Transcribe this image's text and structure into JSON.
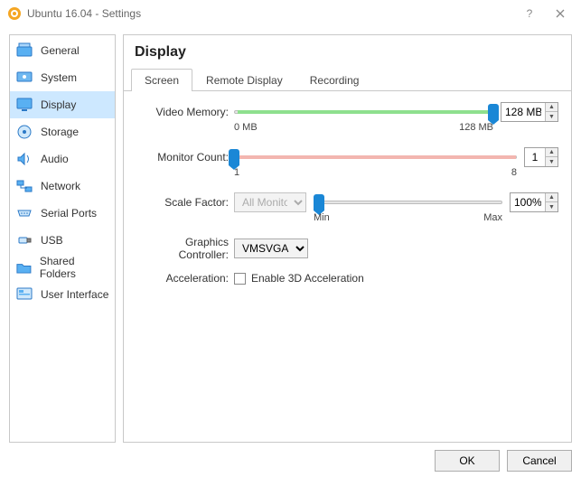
{
  "window": {
    "app": "Ubuntu 16.04",
    "suffix": "Settings"
  },
  "sidebar": {
    "items": [
      {
        "label": "General"
      },
      {
        "label": "System"
      },
      {
        "label": "Display"
      },
      {
        "label": "Storage"
      },
      {
        "label": "Audio"
      },
      {
        "label": "Network"
      },
      {
        "label": "Serial Ports"
      },
      {
        "label": "USB"
      },
      {
        "label": "Shared Folders"
      },
      {
        "label": "User Interface"
      }
    ],
    "selected_index": 2
  },
  "page": {
    "title": "Display"
  },
  "tabs": {
    "items": [
      "Screen",
      "Remote Display",
      "Recording"
    ],
    "active_index": 0
  },
  "screen": {
    "video_memory": {
      "label": "Video Memory:",
      "value": "128 MB",
      "min_label": "0 MB",
      "max_label": "128 MB",
      "thumb_pct": 100,
      "green_start_pct": 1,
      "green_end_pct": 100
    },
    "monitor_count": {
      "label": "Monitor Count:",
      "value": "1",
      "min_label": "1",
      "max_label": "8",
      "thumb_pct": 0,
      "pink_start_pct": 1,
      "pink_end_pct": 100
    },
    "scale": {
      "label": "Scale Factor:",
      "combo": "All Monitors",
      "value": "100%",
      "min_label": "Min",
      "max_label": "Max",
      "thumb_pct": 3
    },
    "gfx": {
      "label": "Graphics Controller:",
      "value": "VMSVGA"
    },
    "accel": {
      "label": "Acceleration:",
      "checkbox_label": "Enable 3D Acceleration",
      "checked": false
    }
  },
  "buttons": {
    "ok": "OK",
    "cancel": "Cancel"
  }
}
